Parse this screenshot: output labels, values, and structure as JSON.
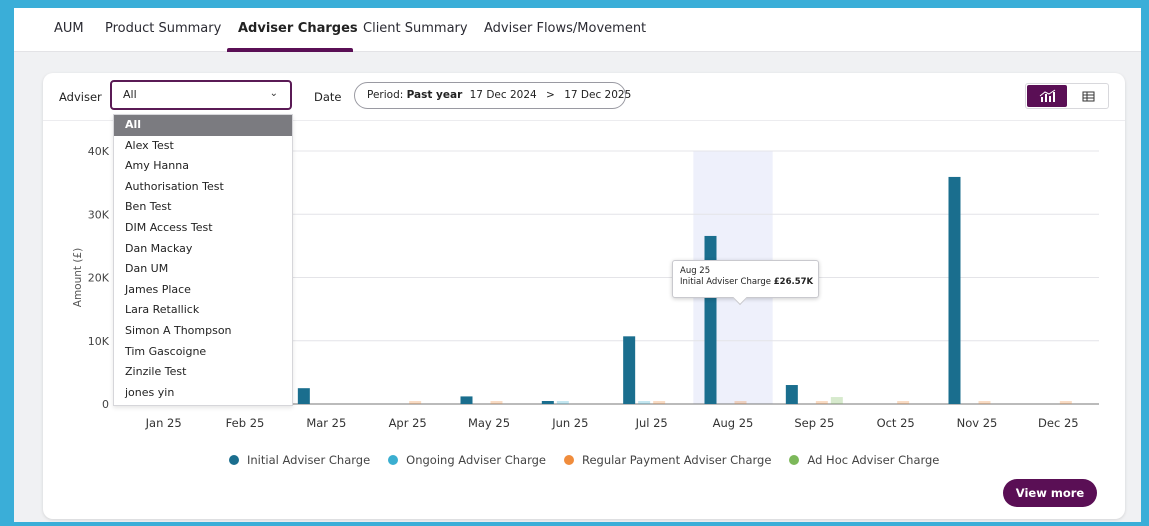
{
  "tabs": [
    {
      "label": "AUM",
      "active": false
    },
    {
      "label": "Product Summary",
      "active": false
    },
    {
      "label": "Adviser Charges",
      "active": true
    },
    {
      "label": "Client Summary",
      "active": false
    },
    {
      "label": "Adviser Flows/Movement",
      "active": false
    }
  ],
  "filters": {
    "adviser_label": "Adviser",
    "adviser_value": "All",
    "date_label": "Date",
    "period_prefix": "Period:",
    "period_value": "Past year",
    "period_start": "17 Dec 2024",
    "period_sep": ">",
    "period_end": "17 Dec 2025"
  },
  "view_toggle": {
    "active": "chart",
    "icons": [
      "bar-chart-icon",
      "table-icon"
    ]
  },
  "adviser_dropdown": {
    "selected": "All",
    "options": [
      "All",
      "Alex Test",
      "Amy Hanna",
      "Authorisation Test",
      "Ben Test",
      "DIM Access Test",
      "Dan Mackay",
      "Dan UM",
      "James Place",
      "Lara Retallick",
      "Simon A Thompson",
      "Tim Gascoigne",
      "Zinzile Test",
      "jones yin"
    ]
  },
  "tooltip": {
    "month": "Aug 25",
    "label": "Initial Adviser Charge",
    "value": "£26.57K"
  },
  "chart_data": {
    "type": "bar",
    "ylabel": "Amount (£)",
    "xlabel": "",
    "ylim": [
      0,
      40000
    ],
    "yticks": [
      "0",
      "10K",
      "20K",
      "30K",
      "40K"
    ],
    "grid": true,
    "categories": [
      "Jan 25",
      "Feb 25",
      "Mar 25",
      "Apr 25",
      "May 25",
      "Jun 25",
      "Jul 25",
      "Aug 25",
      "Sep 25",
      "Oct 25",
      "Nov 25",
      "Dec 25"
    ],
    "highlighted_category": "Aug 25",
    "series": [
      {
        "name": "Initial Adviser Charge",
        "color": "#1a6e8e",
        "values": [
          0,
          0,
          2500,
          0,
          1200,
          400,
          10700,
          26570,
          3000,
          0,
          35900,
          0
        ]
      },
      {
        "name": "Ongoing Adviser Charge",
        "color": "#3aaed0",
        "values": [
          0,
          0,
          0,
          0,
          0,
          200,
          300,
          0,
          0,
          0,
          0,
          0
        ]
      },
      {
        "name": "Regular Payment Adviser Charge",
        "color": "#f08c3c",
        "values": [
          0,
          0,
          0,
          300,
          300,
          0,
          300,
          300,
          400,
          400,
          400,
          300
        ]
      },
      {
        "name": "Ad Hoc Adviser Charge",
        "color": "#7cb85a",
        "values": [
          0,
          0,
          0,
          0,
          0,
          0,
          0,
          0,
          1100,
          0,
          0,
          0
        ]
      }
    ]
  },
  "buttons": {
    "view_more": "View more"
  }
}
